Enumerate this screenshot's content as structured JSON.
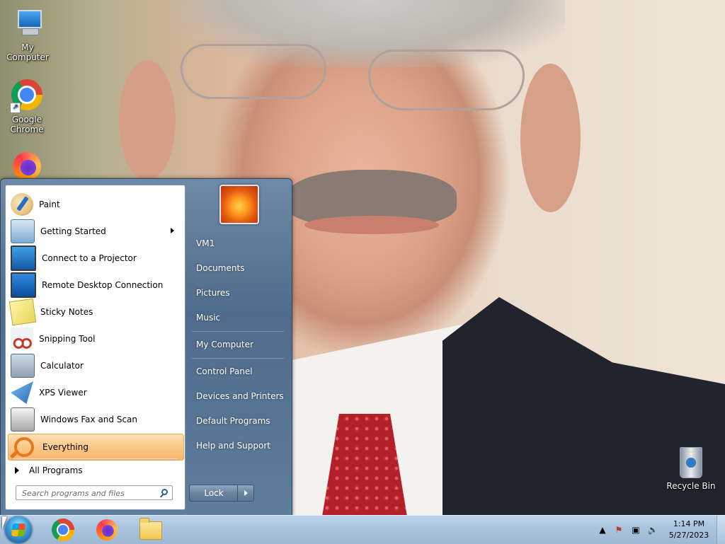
{
  "desktop": {
    "icons": [
      {
        "label": "My Computer",
        "icon": "computer-icon"
      },
      {
        "label": "Google Chrome",
        "icon": "chrome-icon"
      },
      {
        "label": "Recycle Bin",
        "icon": "recycle-bin-icon"
      }
    ]
  },
  "start_menu": {
    "programs": [
      {
        "label": "Paint",
        "icon": "paint-icon"
      },
      {
        "label": "Getting Started",
        "icon": "getting-started-icon",
        "submenu": true
      },
      {
        "label": "Connect to a Projector",
        "icon": "projector-icon"
      },
      {
        "label": "Remote Desktop Connection",
        "icon": "remote-desktop-icon"
      },
      {
        "label": "Sticky Notes",
        "icon": "sticky-notes-icon"
      },
      {
        "label": "Snipping Tool",
        "icon": "snipping-tool-icon"
      },
      {
        "label": "Calculator",
        "icon": "calculator-icon"
      },
      {
        "label": "XPS Viewer",
        "icon": "xps-viewer-icon"
      },
      {
        "label": "Windows Fax and Scan",
        "icon": "fax-scan-icon"
      },
      {
        "label": "Everything",
        "icon": "everything-search-icon",
        "selected": true
      }
    ],
    "all_programs": "All Programs",
    "search_placeholder": "Search programs and files",
    "right_items": [
      "VM1",
      "Documents",
      "Pictures",
      "Music",
      "My Computer",
      "Control Panel",
      "Devices and Printers",
      "Default Programs",
      "Help and Support"
    ],
    "lock_label": "Lock"
  },
  "taskbar": {
    "pinned": [
      "chrome-icon",
      "firefox-icon",
      "file-explorer-icon"
    ],
    "clock_time": "1:14 PM",
    "clock_date": "5/27/2023"
  }
}
